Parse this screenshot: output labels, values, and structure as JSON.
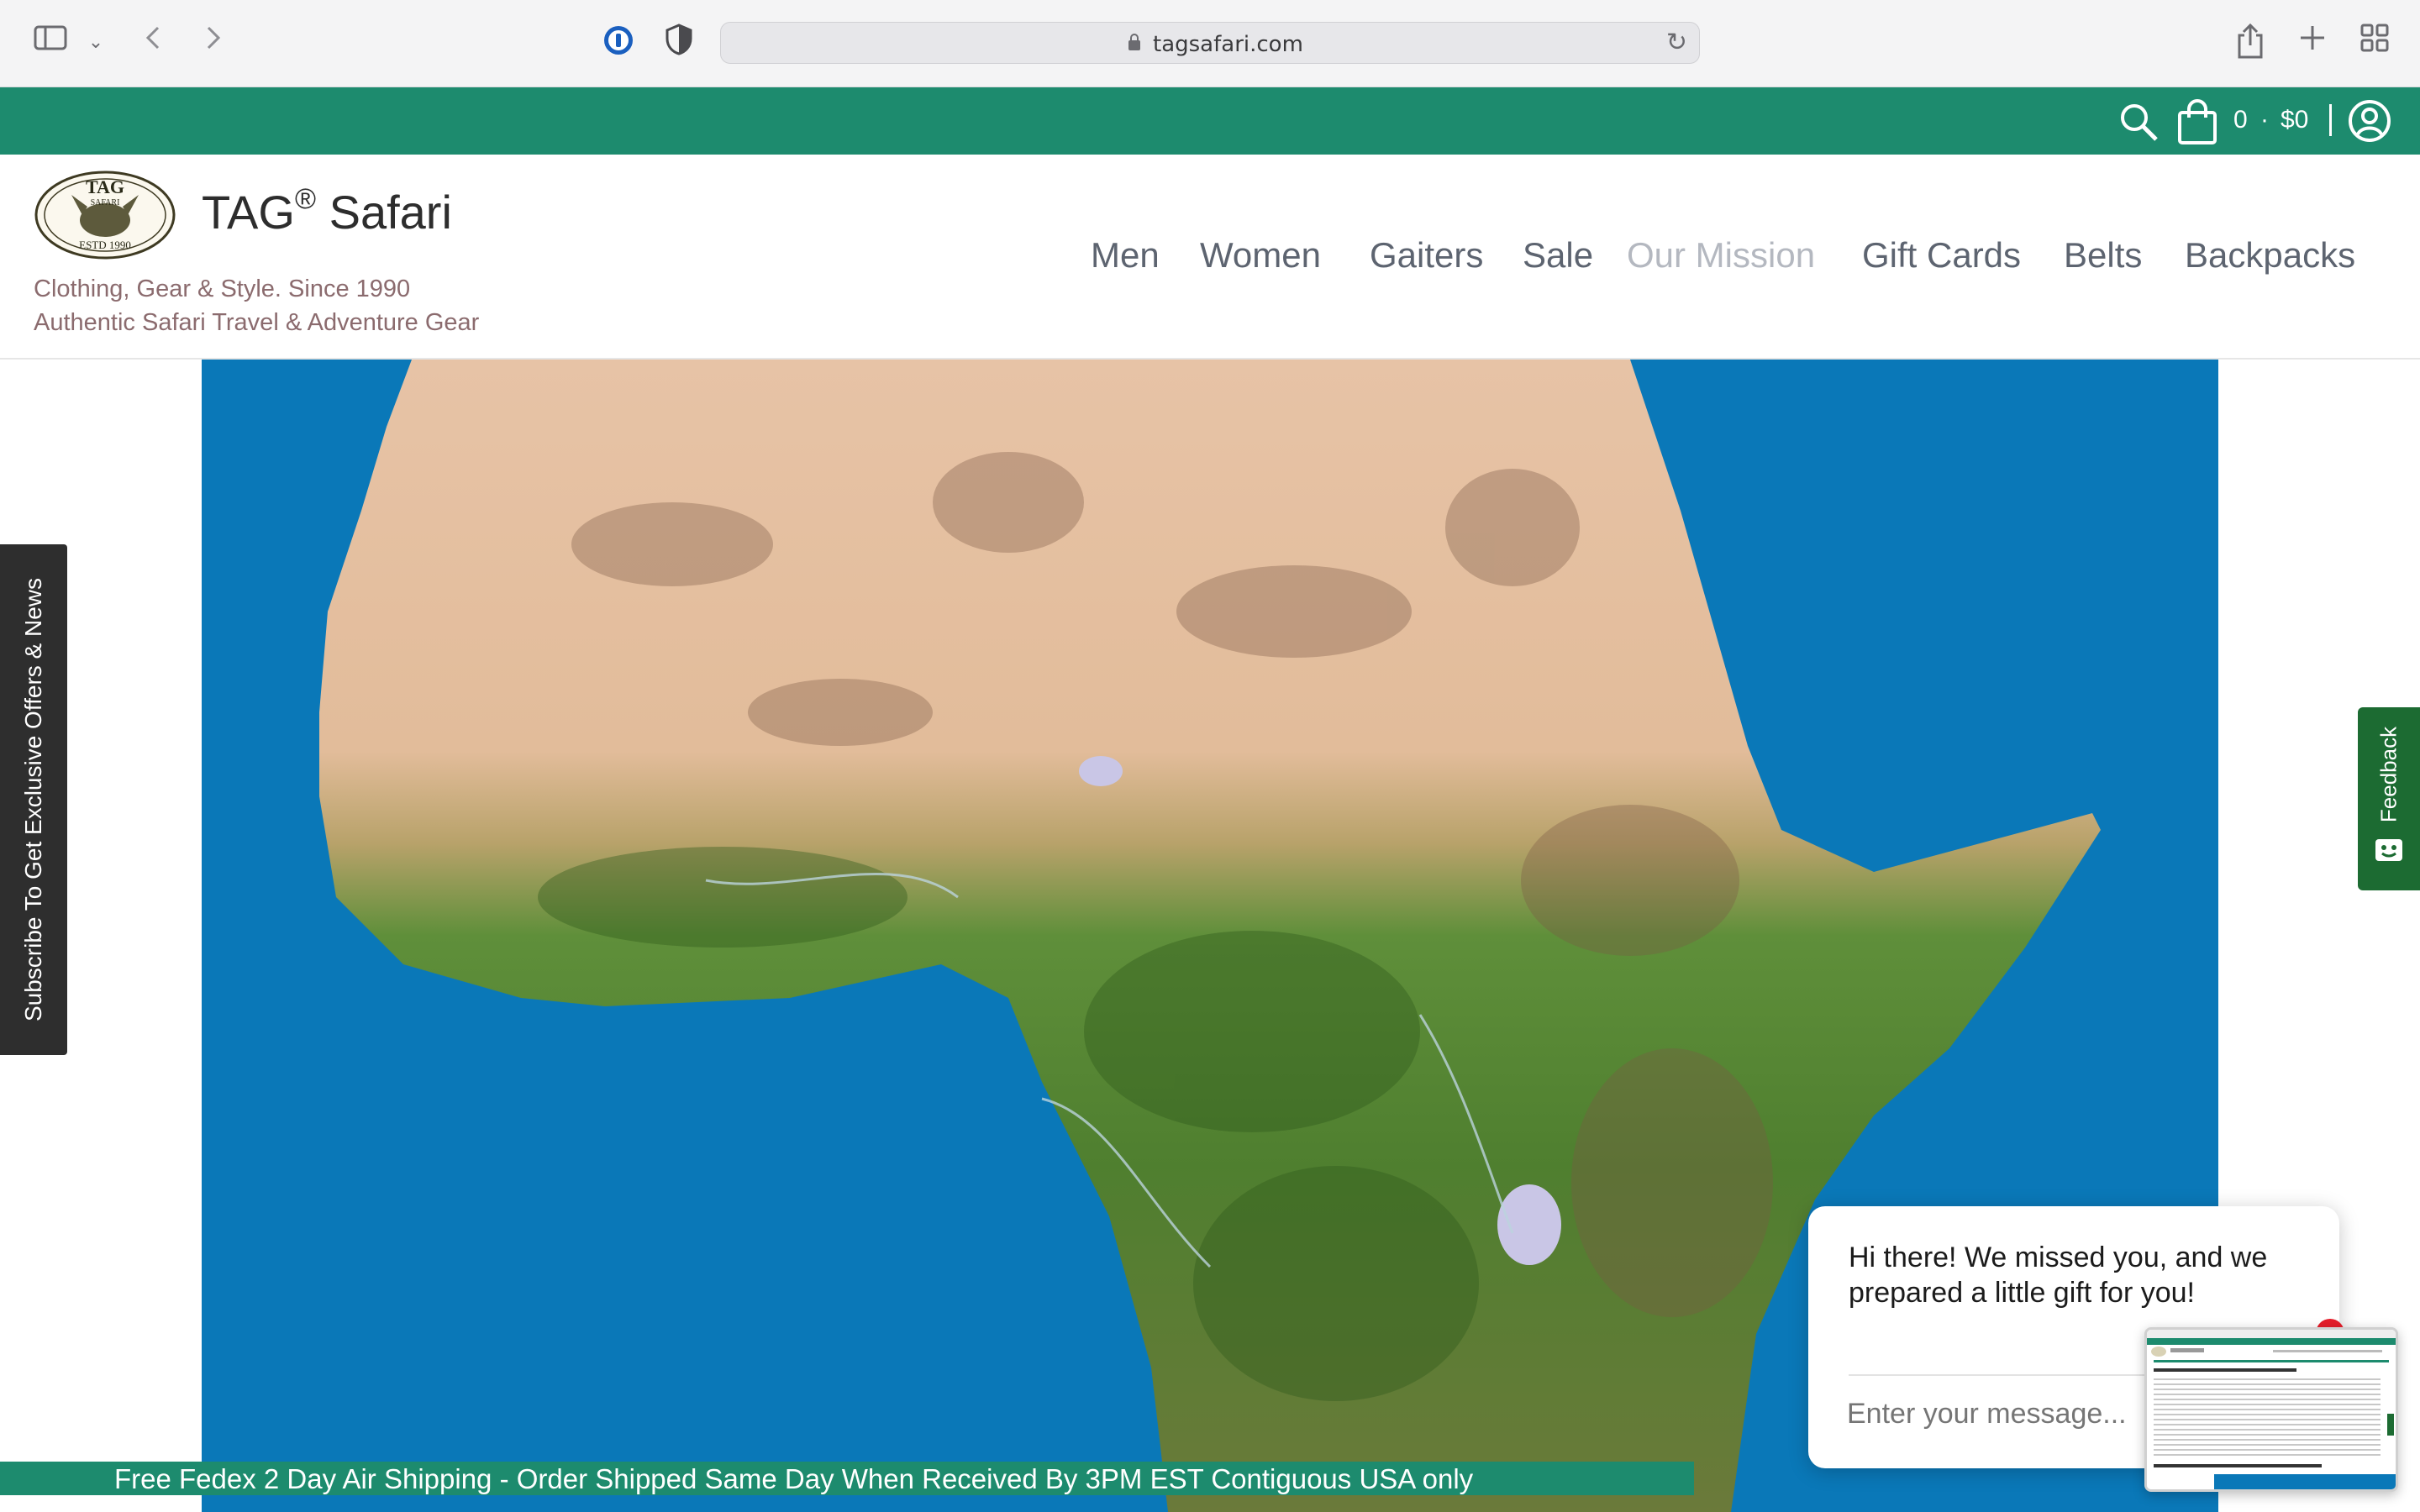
{
  "browser": {
    "url": "tagsafari.com",
    "icons": [
      "sidebar-icon",
      "chevron-down-icon",
      "back-icon",
      "forward-icon",
      "password-manager-icon",
      "privacy-shield-icon",
      "lock-icon",
      "reload-icon",
      "share-icon",
      "new-tab-icon",
      "tab-overview-icon"
    ]
  },
  "utility_bar": {
    "cart_count": "0",
    "cart_separator": "·",
    "cart_total": "$0",
    "accent_color": "#1d8b6e"
  },
  "header": {
    "brand_name": "TAG",
    "brand_registered": "®",
    "brand_suffix": "Safari",
    "tagline_1": "Clothing, Gear & Style. Since 1990",
    "tagline_2": "Authentic Safari Travel & Adventure Gear",
    "logo_text": "TAG",
    "logo_sub": "SAFARI",
    "logo_est": "ESTD 1990"
  },
  "nav": {
    "items": [
      {
        "label": "Men"
      },
      {
        "label": "Women"
      },
      {
        "label": "Gaiters"
      },
      {
        "label": "Sale"
      },
      {
        "label": "Our Mission"
      },
      {
        "label": "Gift Cards"
      },
      {
        "label": "Belts"
      },
      {
        "label": "Backpacks"
      }
    ]
  },
  "side_tabs": {
    "subscribe": "Subscribe To Get Exclusive Offers & News",
    "feedback": "Feedback"
  },
  "chat": {
    "message": "Hi there! We missed you, and we prepared a little gift for you!",
    "input_placeholder": "Enter your message..."
  },
  "banner": {
    "text": "Free Fedex 2 Day Air Shipping - Order Shipped Same Day When Received By 3PM EST Contiguous USA only"
  }
}
